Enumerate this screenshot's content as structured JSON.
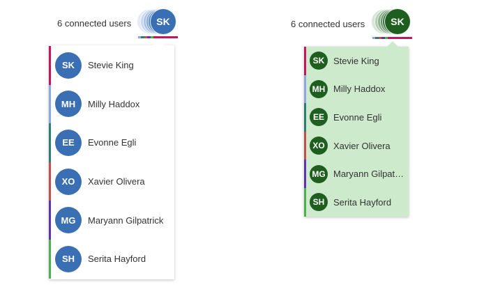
{
  "left_widget": {
    "count_label": "6 connected users",
    "current_user_initials": "SK",
    "avatar_color": "#3a70b3",
    "panel_background": "#ffffff",
    "users": [
      {
        "initials": "SK",
        "name": "Stevie King",
        "color": "#c2185b"
      },
      {
        "initials": "MH",
        "name": "Milly Haddox",
        "color": "#8fa5e0"
      },
      {
        "initials": "EE",
        "name": "Evonne Egli",
        "color": "#2e7d72"
      },
      {
        "initials": "XO",
        "name": "Xavier Olivera",
        "color": "#c0504d"
      },
      {
        "initials": "MG",
        "name": "Maryann Gilpatrick",
        "color": "#5e35b1"
      },
      {
        "initials": "SH",
        "name": "Serita Hayford",
        "color": "#4caf50"
      }
    ]
  },
  "right_widget": {
    "count_label": "6 connected users",
    "current_user_initials": "SK",
    "avatar_color": "#1e5e1e",
    "panel_background": "#cdeacd",
    "users": [
      {
        "initials": "SK",
        "name": "Stevie King",
        "color": "#c2185b"
      },
      {
        "initials": "MH",
        "name": "Milly Haddox",
        "color": "#8fa5e0"
      },
      {
        "initials": "EE",
        "name": "Evonne Egli",
        "color": "#2e7d72"
      },
      {
        "initials": "XO",
        "name": "Xavier Olivera",
        "color": "#c0504d"
      },
      {
        "initials": "MG",
        "name": "Maryann Gilpatrick",
        "color": "#5e35b1"
      },
      {
        "initials": "SH",
        "name": "Serita Hayford",
        "color": "#4caf50"
      }
    ]
  }
}
